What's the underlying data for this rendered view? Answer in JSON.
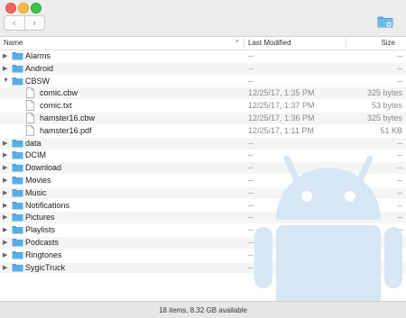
{
  "toolbar": {
    "back_glyph": "‹",
    "forward_glyph": "›",
    "new_folder_icon": "folder-plus-icon"
  },
  "header": {
    "name": "Name",
    "sort_glyph": "^",
    "modified": "Last Modified",
    "size": "Size"
  },
  "rows": [
    {
      "name": "Alarms",
      "modified": "--",
      "size": "--",
      "type": "folder",
      "expanded": false,
      "level": 0
    },
    {
      "name": "Android",
      "modified": "--",
      "size": "--",
      "type": "folder",
      "expanded": false,
      "level": 0
    },
    {
      "name": "CBSW",
      "modified": "--",
      "size": "--",
      "type": "folder",
      "expanded": true,
      "level": 0
    },
    {
      "name": "comic.cbw",
      "modified": "12/25/17, 1:35 PM",
      "size": "325 bytes",
      "type": "file",
      "level": 1
    },
    {
      "name": "comic.txt",
      "modified": "12/25/17, 1:37 PM",
      "size": "53 bytes",
      "type": "file",
      "level": 1
    },
    {
      "name": "hamster16.cbw",
      "modified": "12/25/17, 1:36 PM",
      "size": "325 bytes",
      "type": "file",
      "level": 1
    },
    {
      "name": "hamster16.pdf",
      "modified": "12/25/17, 1:11 PM",
      "size": "51 KB",
      "type": "file",
      "level": 1
    },
    {
      "name": "data",
      "modified": "--",
      "size": "--",
      "type": "folder",
      "expanded": false,
      "level": 0
    },
    {
      "name": "DCIM",
      "modified": "--",
      "size": "--",
      "type": "folder",
      "expanded": false,
      "level": 0
    },
    {
      "name": "Download",
      "modified": "--",
      "size": "--",
      "type": "folder",
      "expanded": false,
      "level": 0
    },
    {
      "name": "Movies",
      "modified": "--",
      "size": "--",
      "type": "folder",
      "expanded": false,
      "level": 0
    },
    {
      "name": "Music",
      "modified": "--",
      "size": "--",
      "type": "folder",
      "expanded": false,
      "level": 0
    },
    {
      "name": "Notifications",
      "modified": "--",
      "size": "--",
      "type": "folder",
      "expanded": false,
      "level": 0
    },
    {
      "name": "Pictures",
      "modified": "--",
      "size": "--",
      "type": "folder",
      "expanded": false,
      "level": 0
    },
    {
      "name": "Playlists",
      "modified": "--",
      "size": "--",
      "type": "folder",
      "expanded": false,
      "level": 0
    },
    {
      "name": "Podcasts",
      "modified": "--",
      "size": "--",
      "type": "folder",
      "expanded": false,
      "level": 0
    },
    {
      "name": "Ringtones",
      "modified": "--",
      "size": "--",
      "type": "folder",
      "expanded": false,
      "level": 0
    },
    {
      "name": "SygicTruck",
      "modified": "--",
      "size": "--",
      "type": "folder",
      "expanded": false,
      "level": 0
    }
  ],
  "status": "18 items, 8.32 GB available",
  "colors": {
    "folder": "#5aaee8",
    "folder_tab": "#4b9edb",
    "android_watermark": "#d6e6f5",
    "stripe": "#f5f5f5"
  },
  "watermark_icon": "android-logo-icon"
}
